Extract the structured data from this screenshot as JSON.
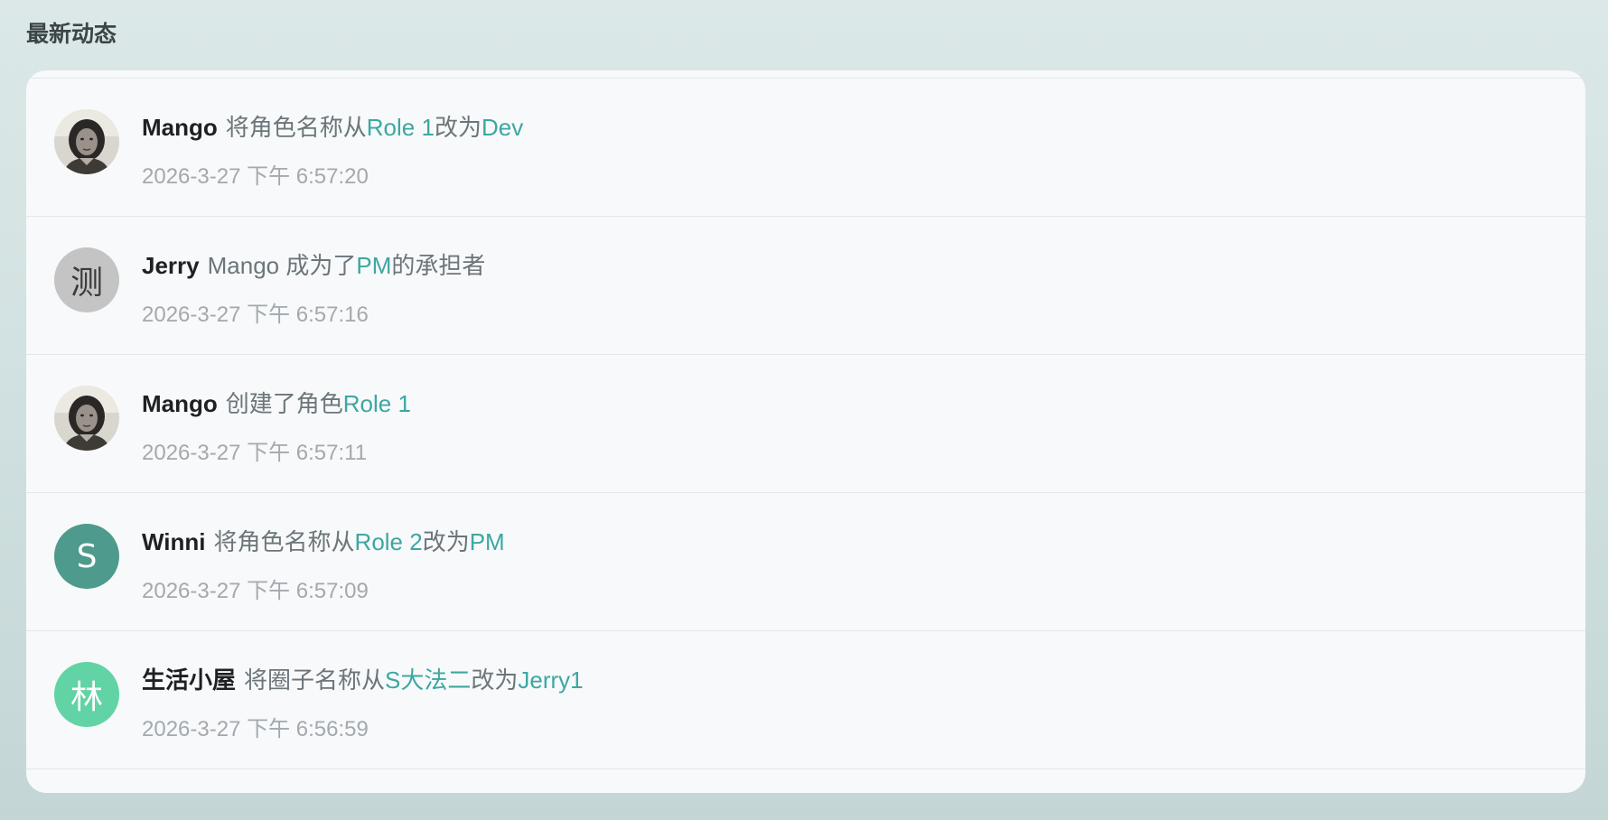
{
  "page": {
    "title": "最新动态"
  },
  "feed": [
    {
      "actor": "Mango",
      "avatar": {
        "type": "photo",
        "letter": ""
      },
      "parts": [
        {
          "kind": "text",
          "value": "将角色名称从"
        },
        {
          "kind": "link",
          "value": "Role 1"
        },
        {
          "kind": "text",
          "value": "改为"
        },
        {
          "kind": "link",
          "value": "Dev"
        }
      ],
      "time": "2026-3-27 下午 6:57:20"
    },
    {
      "actor": "Jerry",
      "avatar": {
        "type": "letter",
        "letter": "测",
        "color": "#c4c4c4"
      },
      "parts": [
        {
          "kind": "text",
          "value": "Mango 成为了"
        },
        {
          "kind": "link",
          "value": "PM"
        },
        {
          "kind": "text",
          "value": "的承担者"
        }
      ],
      "time": "2026-3-27 下午 6:57:16"
    },
    {
      "actor": "Mango",
      "avatar": {
        "type": "photo",
        "letter": ""
      },
      "parts": [
        {
          "kind": "text",
          "value": "创建了角色"
        },
        {
          "kind": "link",
          "value": "Role 1"
        }
      ],
      "time": "2026-3-27 下午 6:57:11"
    },
    {
      "actor": "Winni",
      "avatar": {
        "type": "letter",
        "letter": "S",
        "color": "#4e9a8c"
      },
      "parts": [
        {
          "kind": "text",
          "value": "将角色名称从"
        },
        {
          "kind": "link",
          "value": "Role 2"
        },
        {
          "kind": "text",
          "value": "改为"
        },
        {
          "kind": "link",
          "value": "PM"
        }
      ],
      "time": "2026-3-27 下午 6:57:09"
    },
    {
      "actor": "生活小屋",
      "avatar": {
        "type": "letter",
        "letter": "林",
        "color": "#62d3a4"
      },
      "parts": [
        {
          "kind": "text",
          "value": "将圈子名称从"
        },
        {
          "kind": "link",
          "value": "S大法二"
        },
        {
          "kind": "text",
          "value": "改为"
        },
        {
          "kind": "link",
          "value": "Jerry1"
        }
      ],
      "time": "2026-3-27 下午 6:56:59"
    }
  ],
  "colors": {
    "link": "#3da7a2",
    "actor": "#1d2124",
    "text": "#6c757a",
    "timestamp": "#a3a9ae"
  }
}
